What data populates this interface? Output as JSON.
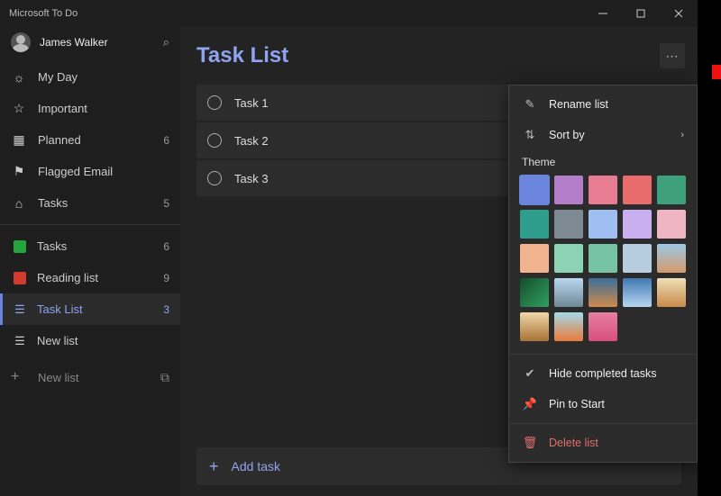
{
  "app_title": "Microsoft To Do",
  "user_name": "James Walker",
  "nav": [
    {
      "icon": "sun",
      "label": "My Day",
      "count": ""
    },
    {
      "icon": "star",
      "label": "Important",
      "count": ""
    },
    {
      "icon": "calendar",
      "label": "Planned",
      "count": "6"
    },
    {
      "icon": "flag",
      "label": "Flagged Email",
      "count": ""
    },
    {
      "icon": "home",
      "label": "Tasks",
      "count": "5"
    }
  ],
  "lists": [
    {
      "kind": "color",
      "color": "#23a53a",
      "check": true,
      "label": "Tasks",
      "count": "6",
      "active": false
    },
    {
      "kind": "color",
      "color": "#d13b2e",
      "label": "Reading list",
      "count": "9",
      "active": false
    },
    {
      "kind": "icon",
      "label": "Task List",
      "count": "3",
      "active": true
    },
    {
      "kind": "icon",
      "label": "New list",
      "count": "",
      "active": false
    }
  ],
  "new_list": "New list",
  "main": {
    "title": "Task List",
    "tasks": [
      "Task 1",
      "Task 2",
      "Task 3"
    ],
    "add_task": "Add task"
  },
  "menu": {
    "rename": "Rename list",
    "sort": "Sort by",
    "theme_label": "Theme",
    "swatches": [
      {
        "c": "#6b84dc",
        "sel": true
      },
      {
        "c": "#b37dc9"
      },
      {
        "c": "#e77c93"
      },
      {
        "c": "#e86b6b"
      },
      {
        "c": "#3fa07c"
      },
      {
        "c": "#2f9d8c"
      },
      {
        "c": "#7d8a93"
      },
      {
        "c": "#9fbef2"
      },
      {
        "c": "#c9aef0"
      },
      {
        "c": "#efb5c2"
      },
      {
        "c": "#f2b48f"
      },
      {
        "c": "#8cd2b5"
      },
      {
        "c": "#76c2a7"
      },
      {
        "c": "#b6cde0"
      },
      {
        "c": "linear-gradient(180deg,#9cc8e6,#d69a6a)"
      },
      {
        "c": "linear-gradient(135deg,#134d2d,#2fa15e)"
      },
      {
        "c": "linear-gradient(180deg,#b9d7ef,#6f8896)"
      },
      {
        "c": "linear-gradient(180deg,#3b6f9a,#d08a4a)"
      },
      {
        "c": "linear-gradient(180deg,#3f78b0,#b7d6f2)"
      },
      {
        "c": "linear-gradient(180deg,#efe0b8,#c78a4a)"
      },
      {
        "c": "linear-gradient(180deg,#f0d7a8,#a87234)"
      },
      {
        "c": "linear-gradient(180deg,#a5d9ea,#e97a3a)"
      },
      {
        "c": "linear-gradient(180deg,#e87ea3,#d74f7c)"
      }
    ],
    "hide": "Hide completed tasks",
    "pin": "Pin to Start",
    "delete": "Delete list"
  }
}
